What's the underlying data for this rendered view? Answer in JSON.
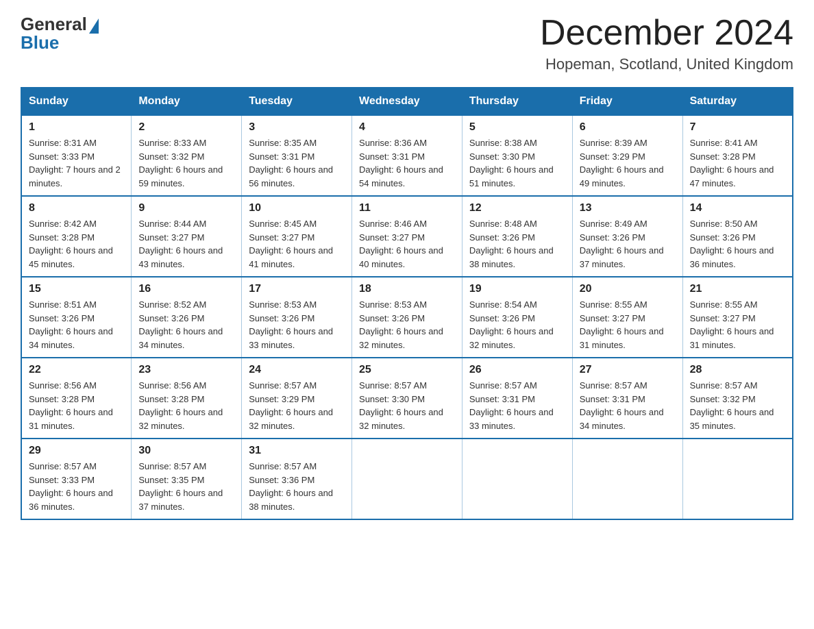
{
  "logo": {
    "general": "General",
    "blue": "Blue"
  },
  "title": {
    "month_year": "December 2024",
    "location": "Hopeman, Scotland, United Kingdom"
  },
  "headers": [
    "Sunday",
    "Monday",
    "Tuesday",
    "Wednesday",
    "Thursday",
    "Friday",
    "Saturday"
  ],
  "weeks": [
    [
      {
        "day": "1",
        "sunrise": "8:31 AM",
        "sunset": "3:33 PM",
        "daylight": "7 hours and 2 minutes."
      },
      {
        "day": "2",
        "sunrise": "8:33 AM",
        "sunset": "3:32 PM",
        "daylight": "6 hours and 59 minutes."
      },
      {
        "day": "3",
        "sunrise": "8:35 AM",
        "sunset": "3:31 PM",
        "daylight": "6 hours and 56 minutes."
      },
      {
        "day": "4",
        "sunrise": "8:36 AM",
        "sunset": "3:31 PM",
        "daylight": "6 hours and 54 minutes."
      },
      {
        "day": "5",
        "sunrise": "8:38 AM",
        "sunset": "3:30 PM",
        "daylight": "6 hours and 51 minutes."
      },
      {
        "day": "6",
        "sunrise": "8:39 AM",
        "sunset": "3:29 PM",
        "daylight": "6 hours and 49 minutes."
      },
      {
        "day": "7",
        "sunrise": "8:41 AM",
        "sunset": "3:28 PM",
        "daylight": "6 hours and 47 minutes."
      }
    ],
    [
      {
        "day": "8",
        "sunrise": "8:42 AM",
        "sunset": "3:28 PM",
        "daylight": "6 hours and 45 minutes."
      },
      {
        "day": "9",
        "sunrise": "8:44 AM",
        "sunset": "3:27 PM",
        "daylight": "6 hours and 43 minutes."
      },
      {
        "day": "10",
        "sunrise": "8:45 AM",
        "sunset": "3:27 PM",
        "daylight": "6 hours and 41 minutes."
      },
      {
        "day": "11",
        "sunrise": "8:46 AM",
        "sunset": "3:27 PM",
        "daylight": "6 hours and 40 minutes."
      },
      {
        "day": "12",
        "sunrise": "8:48 AM",
        "sunset": "3:26 PM",
        "daylight": "6 hours and 38 minutes."
      },
      {
        "day": "13",
        "sunrise": "8:49 AM",
        "sunset": "3:26 PM",
        "daylight": "6 hours and 37 minutes."
      },
      {
        "day": "14",
        "sunrise": "8:50 AM",
        "sunset": "3:26 PM",
        "daylight": "6 hours and 36 minutes."
      }
    ],
    [
      {
        "day": "15",
        "sunrise": "8:51 AM",
        "sunset": "3:26 PM",
        "daylight": "6 hours and 34 minutes."
      },
      {
        "day": "16",
        "sunrise": "8:52 AM",
        "sunset": "3:26 PM",
        "daylight": "6 hours and 34 minutes."
      },
      {
        "day": "17",
        "sunrise": "8:53 AM",
        "sunset": "3:26 PM",
        "daylight": "6 hours and 33 minutes."
      },
      {
        "day": "18",
        "sunrise": "8:53 AM",
        "sunset": "3:26 PM",
        "daylight": "6 hours and 32 minutes."
      },
      {
        "day": "19",
        "sunrise": "8:54 AM",
        "sunset": "3:26 PM",
        "daylight": "6 hours and 32 minutes."
      },
      {
        "day": "20",
        "sunrise": "8:55 AM",
        "sunset": "3:27 PM",
        "daylight": "6 hours and 31 minutes."
      },
      {
        "day": "21",
        "sunrise": "8:55 AM",
        "sunset": "3:27 PM",
        "daylight": "6 hours and 31 minutes."
      }
    ],
    [
      {
        "day": "22",
        "sunrise": "8:56 AM",
        "sunset": "3:28 PM",
        "daylight": "6 hours and 31 minutes."
      },
      {
        "day": "23",
        "sunrise": "8:56 AM",
        "sunset": "3:28 PM",
        "daylight": "6 hours and 32 minutes."
      },
      {
        "day": "24",
        "sunrise": "8:57 AM",
        "sunset": "3:29 PM",
        "daylight": "6 hours and 32 minutes."
      },
      {
        "day": "25",
        "sunrise": "8:57 AM",
        "sunset": "3:30 PM",
        "daylight": "6 hours and 32 minutes."
      },
      {
        "day": "26",
        "sunrise": "8:57 AM",
        "sunset": "3:31 PM",
        "daylight": "6 hours and 33 minutes."
      },
      {
        "day": "27",
        "sunrise": "8:57 AM",
        "sunset": "3:31 PM",
        "daylight": "6 hours and 34 minutes."
      },
      {
        "day": "28",
        "sunrise": "8:57 AM",
        "sunset": "3:32 PM",
        "daylight": "6 hours and 35 minutes."
      }
    ],
    [
      {
        "day": "29",
        "sunrise": "8:57 AM",
        "sunset": "3:33 PM",
        "daylight": "6 hours and 36 minutes."
      },
      {
        "day": "30",
        "sunrise": "8:57 AM",
        "sunset": "3:35 PM",
        "daylight": "6 hours and 37 minutes."
      },
      {
        "day": "31",
        "sunrise": "8:57 AM",
        "sunset": "3:36 PM",
        "daylight": "6 hours and 38 minutes."
      },
      null,
      null,
      null,
      null
    ]
  ]
}
